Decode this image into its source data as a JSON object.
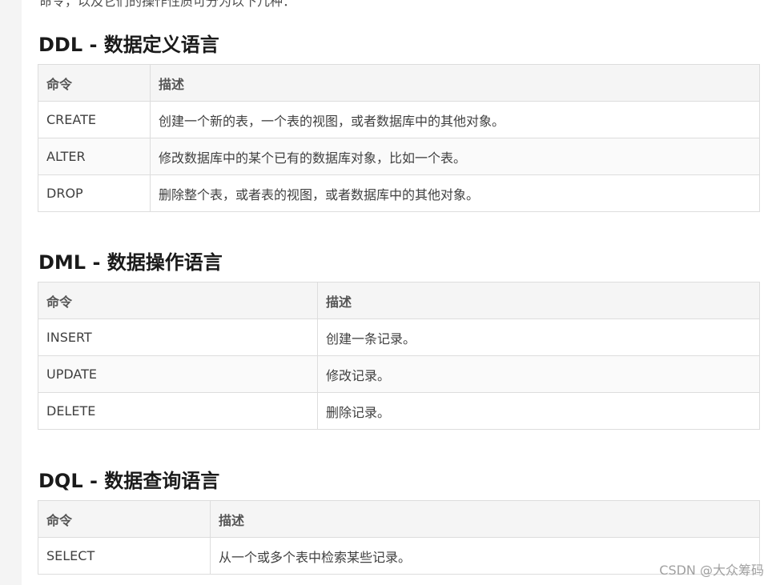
{
  "intro_text": "命令，以及它们的操作性质可分为以下几种：",
  "sections": [
    {
      "heading": "DDL - 数据定义语言",
      "columns": [
        "命令",
        "描述"
      ],
      "rows": [
        {
          "command": "CREATE",
          "description": "创建一个新的表，一个表的视图，或者数据库中的其他对象。"
        },
        {
          "command": "ALTER",
          "description": "修改数据库中的某个已有的数据库对象，比如一个表。"
        },
        {
          "command": "DROP",
          "description": "删除整个表，或者表的视图，或者数据库中的其他对象。"
        }
      ]
    },
    {
      "heading": "DML - 数据操作语言",
      "columns": [
        "命令",
        "描述"
      ],
      "rows": [
        {
          "command": "INSERT",
          "description": "创建一条记录。"
        },
        {
          "command": "UPDATE",
          "description": "修改记录。"
        },
        {
          "command": "DELETE",
          "description": "删除记录。"
        }
      ]
    },
    {
      "heading": "DQL - 数据查询语言",
      "columns": [
        "命令",
        "描述"
      ],
      "rows": [
        {
          "command": "SELECT",
          "description": "从一个或多个表中检索某些记录。"
        }
      ]
    }
  ],
  "watermark": "CSDN @大众筹码"
}
